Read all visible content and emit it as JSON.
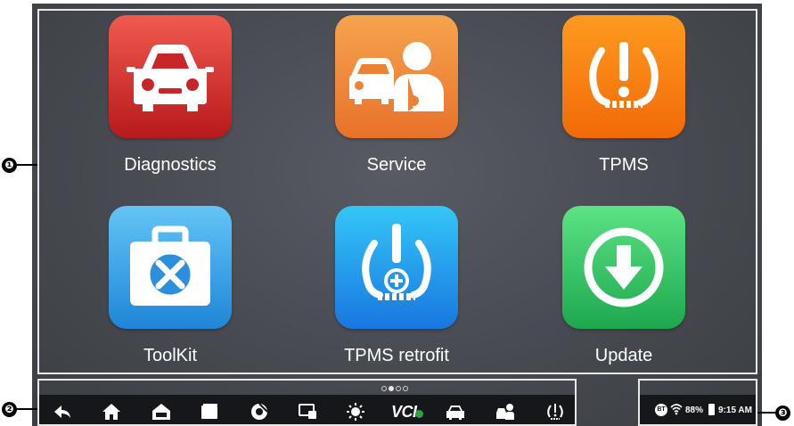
{
  "apps": [
    {
      "label": "Diagnostics",
      "icon": "car-front-icon",
      "color_top": "#f05a4f",
      "color_bottom": "#b8191c"
    },
    {
      "label": "Service",
      "icon": "service-technician-icon",
      "color_top": "#f5a44e",
      "color_bottom": "#e8722a"
    },
    {
      "label": "TPMS",
      "icon": "tire-pressure-icon",
      "color_top": "#ff9a1f",
      "color_bottom": "#f26a08"
    },
    {
      "label": "ToolKit",
      "icon": "toolbox-icon",
      "color_top": "#64c4f6",
      "color_bottom": "#1f86d8"
    },
    {
      "label": "TPMS retrofit",
      "icon": "tire-pressure-plus-icon",
      "color_top": "#35c6f7",
      "color_bottom": "#1877e0"
    },
    {
      "label": "Update",
      "icon": "download-arrow-icon",
      "color_top": "#5de285",
      "color_bottom": "#1ea84e"
    }
  ],
  "callouts": {
    "apps": "❶",
    "nav": "❷",
    "status": "❸"
  },
  "navbar": {
    "items": [
      "back-icon",
      "home-icon",
      "autel-home-icon",
      "recent-apps-icon",
      "browser-icon",
      "screen-capture-icon",
      "brightness-icon",
      "vci-icon",
      "diagnostics-shortcut-icon",
      "service-shortcut-icon",
      "tpms-shortcut-icon"
    ],
    "vci_label": "VCI"
  },
  "status": {
    "bluetooth": "BT",
    "battery": "88%",
    "time": "9:15 AM"
  },
  "pager": {
    "pages": 4,
    "current": 2
  }
}
